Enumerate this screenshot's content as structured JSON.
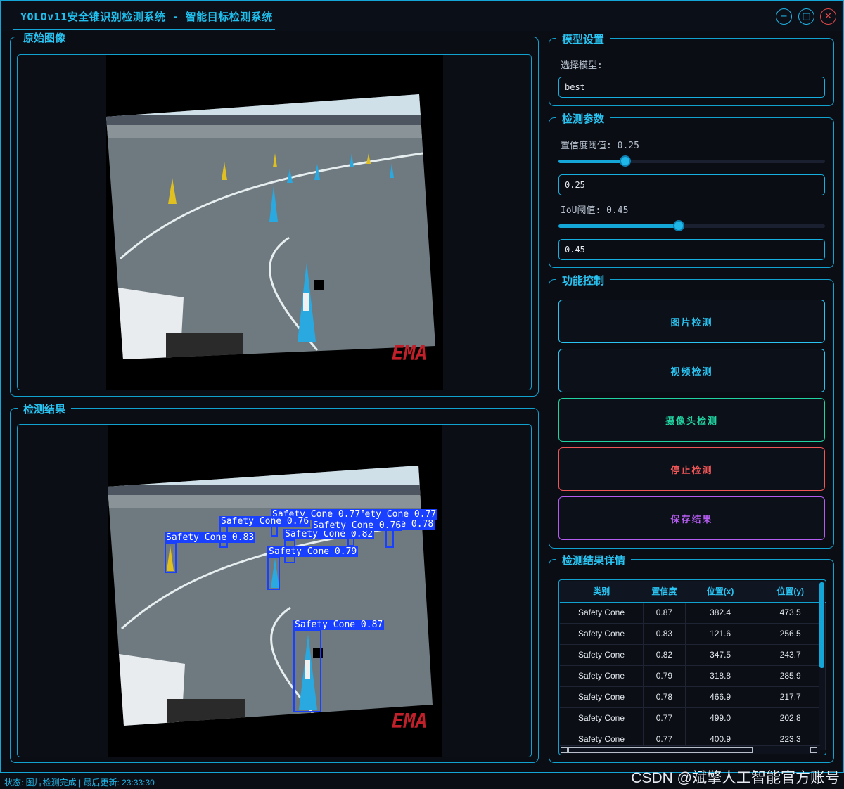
{
  "window": {
    "title": "YOLOv11安全锥识别检测系统 - 智能目标检测系统",
    "min_glyph": "−",
    "max_glyph": "□",
    "close_glyph": "✕"
  },
  "original_panel": {
    "title": "原始图像",
    "overlay_logo": "EMA"
  },
  "result_panel": {
    "title": "检测结果",
    "overlay_logo": "EMA",
    "detections": [
      {
        "label": "Safety Cone 0.87"
      },
      {
        "label": "Safety Cone 0.83"
      },
      {
        "label": "Safety Cone 0.82"
      },
      {
        "label": "Safety Cone 0.79"
      },
      {
        "label": "Safety Cone 0.78"
      },
      {
        "label": "Safety Cone 0.77"
      },
      {
        "label": "Safety Cone 0.77"
      },
      {
        "label": "Safety Cone 0.76"
      },
      {
        "label": "Safety Cone 0.76"
      }
    ]
  },
  "model_settings": {
    "title": "模型设置",
    "select_label": "选择模型:",
    "selected_model": "best"
  },
  "detection_params": {
    "title": "检测参数",
    "conf_label": "置信度阈值: 0.25",
    "conf_value": "0.25",
    "conf_fraction": 0.25,
    "iou_label": "IoU阈值: 0.45",
    "iou_value": "0.45",
    "iou_fraction": 0.45
  },
  "controls": {
    "title": "功能控制",
    "image_detect": "图片检测",
    "video_detect": "视频检测",
    "camera_detect": "摄像头检测",
    "stop_detect": "停止检测",
    "save_results": "保存结果",
    "colors": {
      "image": "#29c4f2",
      "video": "#29c4f2",
      "camera": "#21d3a0",
      "stop": "#f05656",
      "save": "#b45cf0"
    }
  },
  "results_table": {
    "title": "检测结果详情",
    "headers": [
      "类别",
      "置信度",
      "位置(x)",
      "位置(y)"
    ],
    "rows": [
      [
        "Safety Cone",
        "0.87",
        "382.4",
        "473.5"
      ],
      [
        "Safety Cone",
        "0.83",
        "121.6",
        "256.5"
      ],
      [
        "Safety Cone",
        "0.82",
        "347.5",
        "243.7"
      ],
      [
        "Safety Cone",
        "0.79",
        "318.8",
        "285.9"
      ],
      [
        "Safety Cone",
        "0.78",
        "466.9",
        "217.7"
      ],
      [
        "Safety Cone",
        "0.77",
        "499.0",
        "202.8"
      ],
      [
        "Safety Cone",
        "0.77",
        "400.9",
        "223.3"
      ]
    ]
  },
  "status": {
    "text": "状态: 图片检测完成 | 最后更新: 23:33:30"
  },
  "watermark": "CSDN @斌擎人工智能官方账号"
}
